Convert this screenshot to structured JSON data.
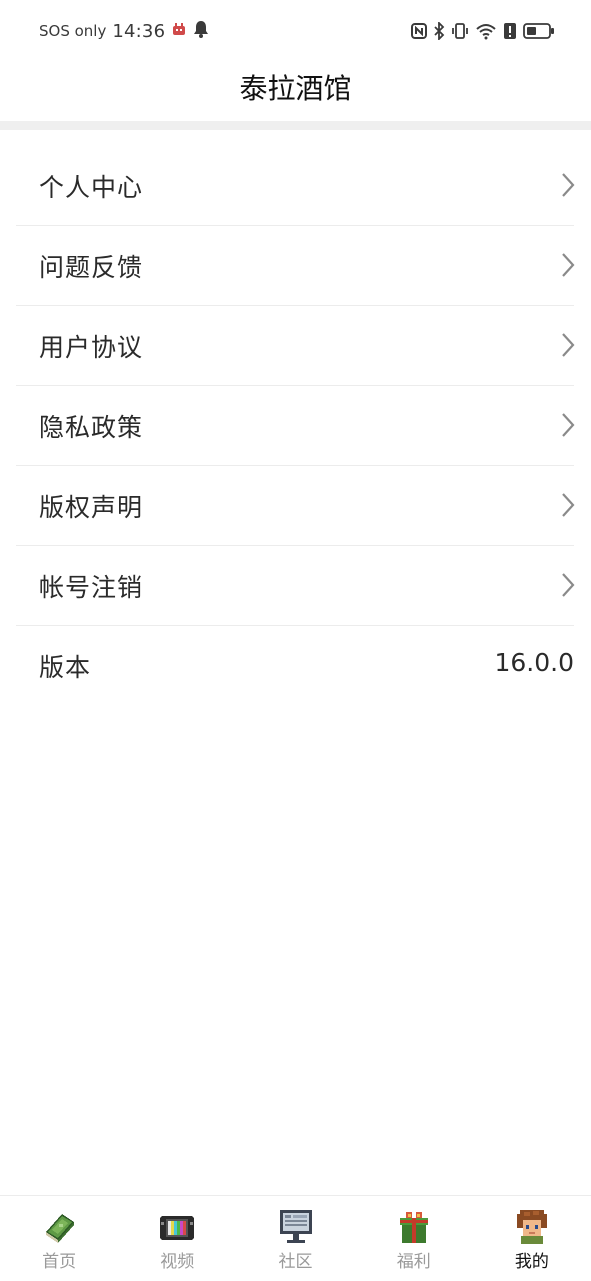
{
  "status_bar": {
    "carrier": "SOS only",
    "time": "14:36"
  },
  "header": {
    "title": "泰拉酒馆"
  },
  "menu": {
    "items": [
      {
        "label": "个人中心"
      },
      {
        "label": "问题反馈"
      },
      {
        "label": "用户协议"
      },
      {
        "label": "隐私政策"
      },
      {
        "label": "版权声明"
      },
      {
        "label": "帐号注销"
      }
    ],
    "version_label": "版本",
    "version_value": "16.0.0"
  },
  "bottom_nav": {
    "items": [
      {
        "label": "首页",
        "icon": "book-icon"
      },
      {
        "label": "视频",
        "icon": "tv-icon"
      },
      {
        "label": "社区",
        "icon": "monitor-icon"
      },
      {
        "label": "福利",
        "icon": "gift-icon"
      },
      {
        "label": "我的",
        "icon": "avatar-icon"
      }
    ],
    "active_index": 4
  },
  "colors": {
    "divider": "#efefef",
    "inactive_text": "#9a9a9a",
    "active_text": "#111111"
  }
}
